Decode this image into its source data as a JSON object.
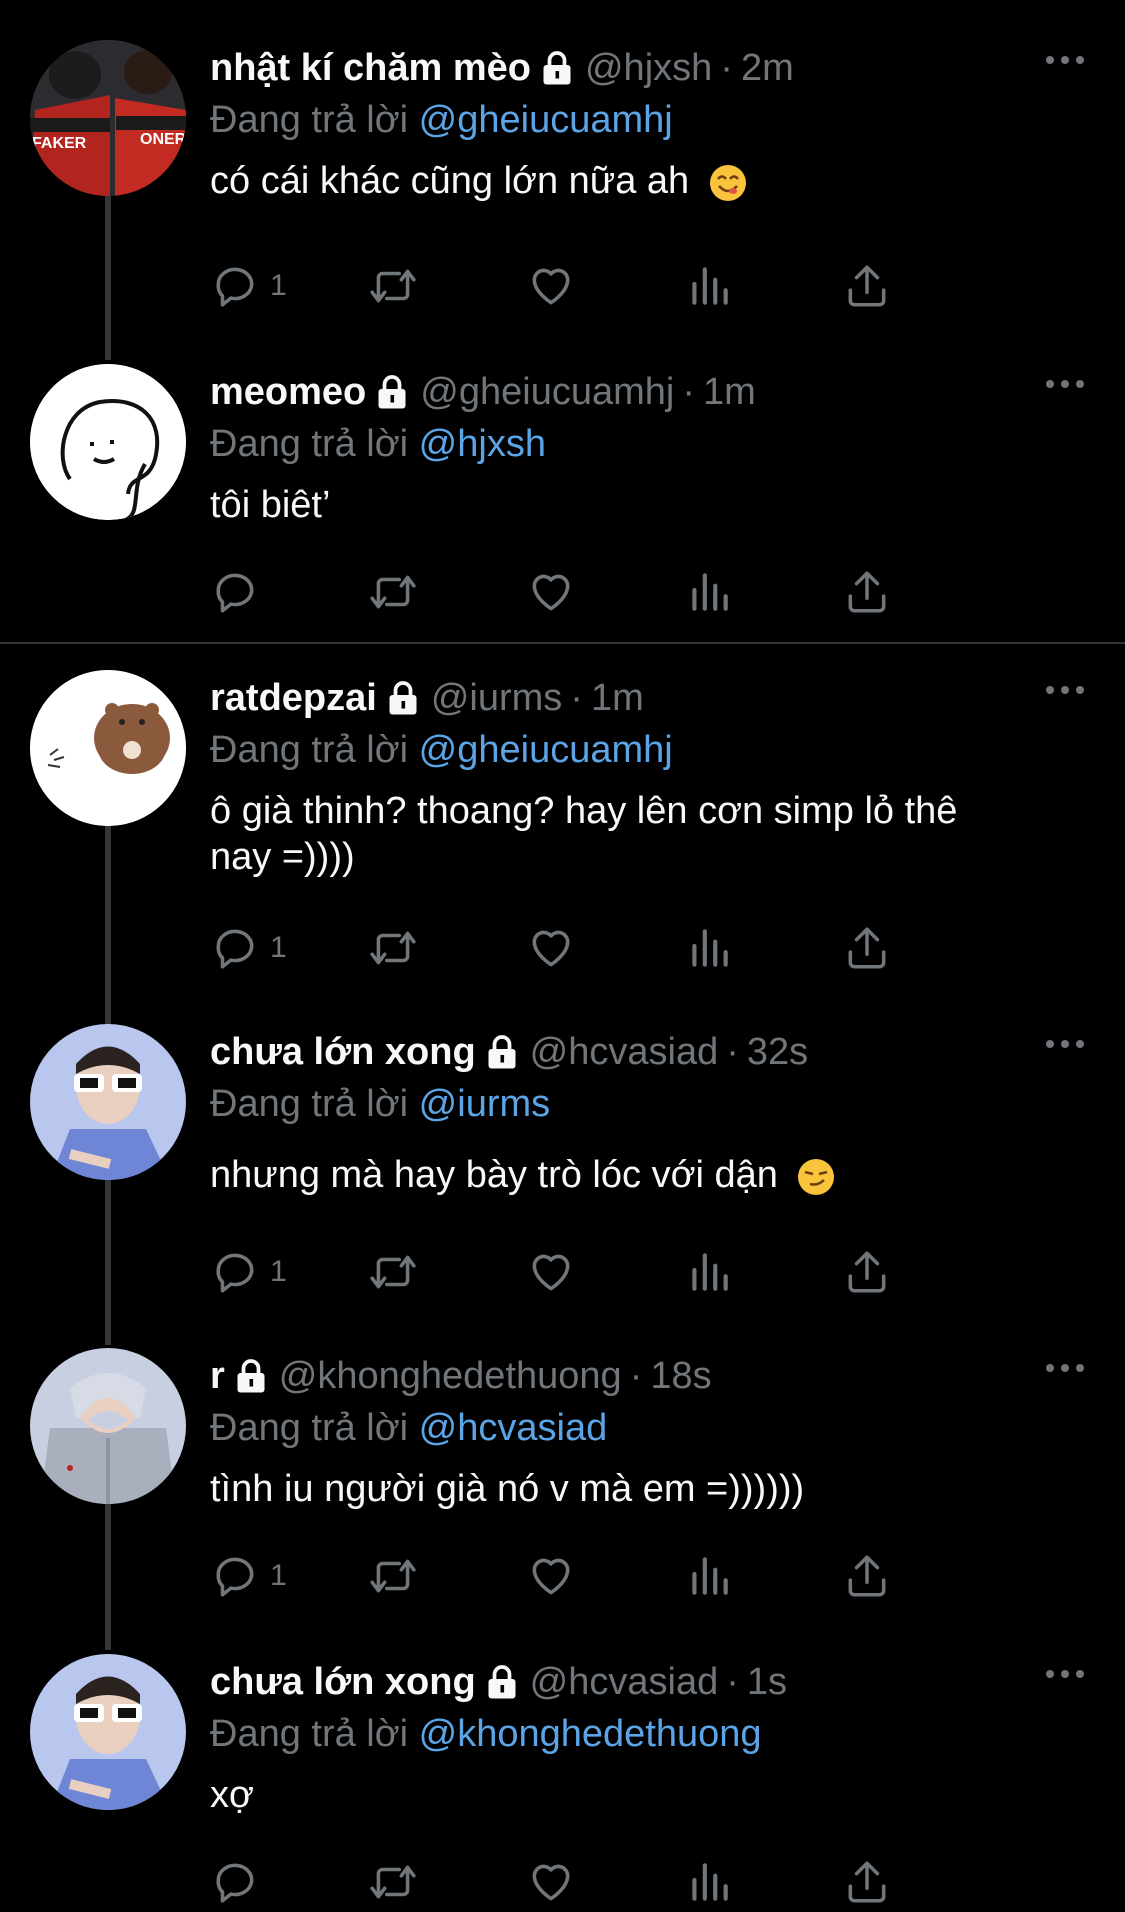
{
  "tweets": [
    {
      "name": "nhật kí chăm mèo",
      "handle": "@hjxsh",
      "time": "2m",
      "reply_label": "Đang trả lời",
      "reply_to": "@gheiucuamhj",
      "text": "có cái khác cũng lớn nữa ah",
      "emoji": "yum-emoji",
      "reply_count": "1",
      "avatar_text": [
        "FAKER",
        "ONER"
      ]
    },
    {
      "name": "meomeo",
      "handle": "@gheiucuamhj",
      "time": "1m",
      "reply_label": "Đang trả lời",
      "reply_to": "@hjxsh",
      "text": "tôi biêt’",
      "reply_count": ""
    },
    {
      "name": "ratdepzai",
      "handle": "@iurms",
      "time": "1m",
      "reply_label": "Đang trả lời",
      "reply_to": "@gheiucuamhj",
      "text_line1": "ô già thinh? thoang? hay lên cơn simp lỏ thê",
      "text_line2": "nay =))))",
      "reply_count": "1"
    },
    {
      "name": "chưa lớn xong",
      "handle": "@hcvasiad",
      "time": "32s",
      "reply_label": "Đang trả lời",
      "reply_to": "@iurms",
      "text": "nhưng mà hay bày trò lóc với dận",
      "emoji": "smirk-emoji",
      "reply_count": "1"
    },
    {
      "name": "r",
      "handle": "@khonghedethuong",
      "time": "18s",
      "reply_label": "Đang trả lời",
      "reply_to": "@hcvasiad",
      "text": "tình iu người già nó v mà em =))))))",
      "reply_count": "1"
    },
    {
      "name": "chưa lớn xong",
      "handle": "@hcvasiad",
      "time": "1s",
      "reply_label": "Đang trả lời",
      "reply_to": "@khonghedethuong",
      "text": "xợ",
      "reply_count": ""
    }
  ],
  "colors": {
    "background": "#000000",
    "text": "#f7f9f9",
    "muted": "#71767b",
    "link": "#5ba4e6"
  }
}
